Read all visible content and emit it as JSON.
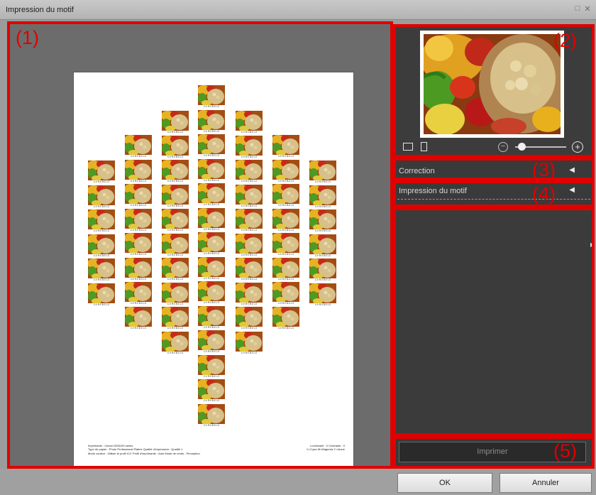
{
  "window": {
    "title": "Impression du motif"
  },
  "callouts": [
    "(1)",
    "(2)",
    "(3)",
    "(4)",
    "(5)"
  ],
  "tile_caption": "C:0 R:0 B:0 L:0",
  "page_footer": {
    "left_lines": [
      "Imprimante : Canon MG5100 series",
      "Type de papier : Photo Professional Platine   Qualité d'impression : Qualité 1",
      "Mode couleur : Utiliser le profil ICC   Profil d'imprimante : Auto   Mode de rendu : Perception"
    ],
    "right_lines": [
      "Luminosité : 0  Contraste : 0",
      "C=Cyan  M=Magenta  Y=Jaune"
    ]
  },
  "preview_tools": {
    "view_icons": [
      "landscape-view-icon",
      "portrait-view-icon"
    ],
    "zoom_level": 0.08
  },
  "sections": {
    "correction": "Correction",
    "pattern_print": "Impression du motif"
  },
  "buttons": {
    "print": "Imprimer",
    "ok": "OK",
    "cancel": "Annuler"
  },
  "colors": {
    "callout_red": "#e00000",
    "panel_dark": "#3a3a3a",
    "preview_gray": "#6c6c6c"
  }
}
